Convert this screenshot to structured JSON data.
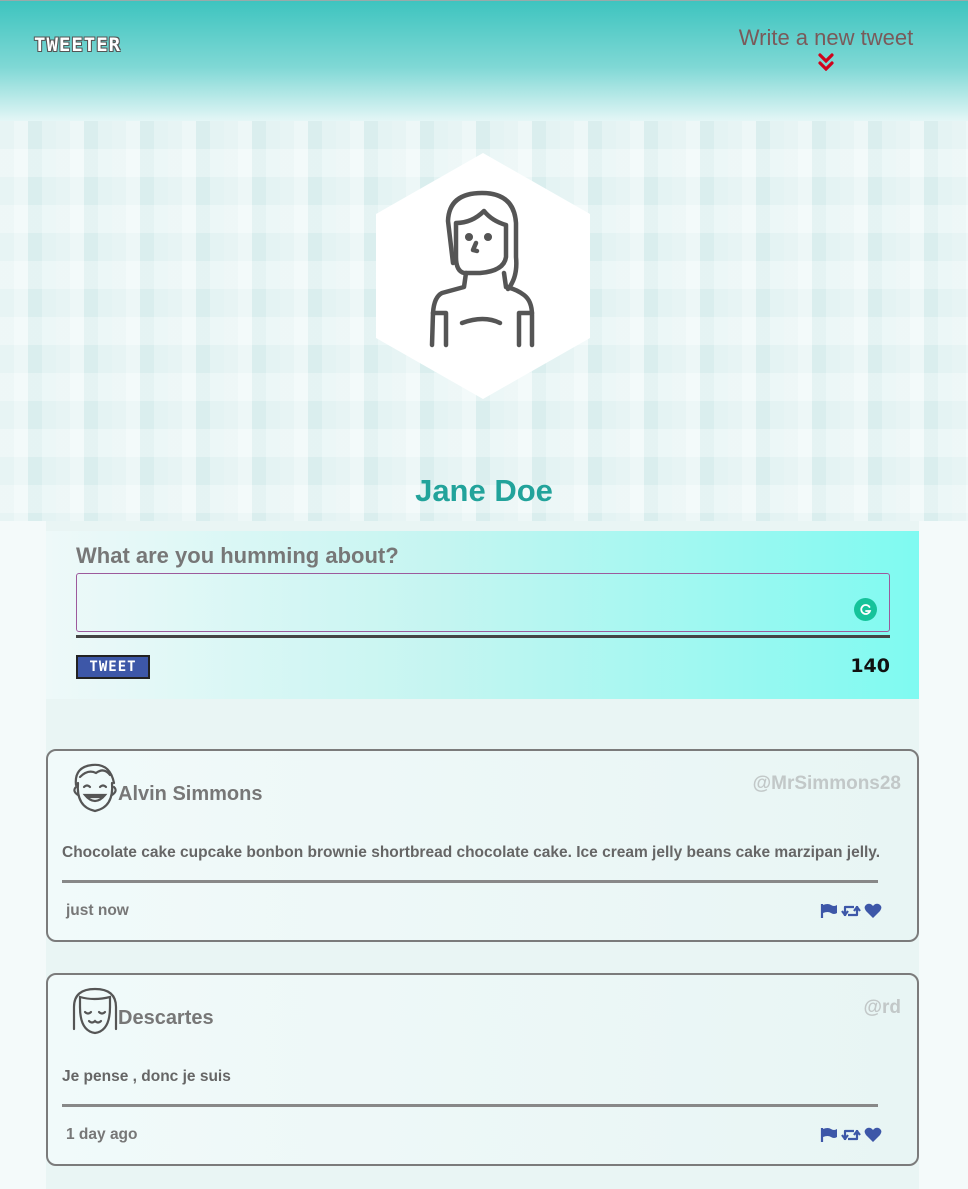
{
  "nav": {
    "brand": "TWEETER",
    "compose_link": "Write a new tweet",
    "compose_icon": "double-chevron-down-icon",
    "accent_color": "#d0021b"
  },
  "profile": {
    "name": "Jane Doe",
    "avatar": "woman-avatar-icon"
  },
  "composer": {
    "prompt": "What are you humming about?",
    "input_value": "",
    "button_label": "TWEET",
    "char_count": "140"
  },
  "tweets": [
    {
      "author": "Alvin Simmons",
      "handle": "@MrSimmons28",
      "avatar": "smiling-man-avatar-icon",
      "content": "Chocolate cake cupcake bonbon brownie shortbread chocolate cake. Ice cream jelly beans cake marzipan jelly.",
      "time": "just now",
      "actions": [
        "flag-icon",
        "retweet-icon",
        "heart-icon"
      ]
    },
    {
      "author": "Descartes",
      "handle": "@rd",
      "avatar": "smiling-girl-avatar-icon",
      "content": "Je pense , donc je suis",
      "time": "1 day ago",
      "actions": [
        "flag-icon",
        "retweet-icon",
        "heart-icon"
      ]
    }
  ],
  "colors": {
    "teal": "#22a39b",
    "button": "#3d57a8",
    "action_icons": "#3d57a8"
  }
}
